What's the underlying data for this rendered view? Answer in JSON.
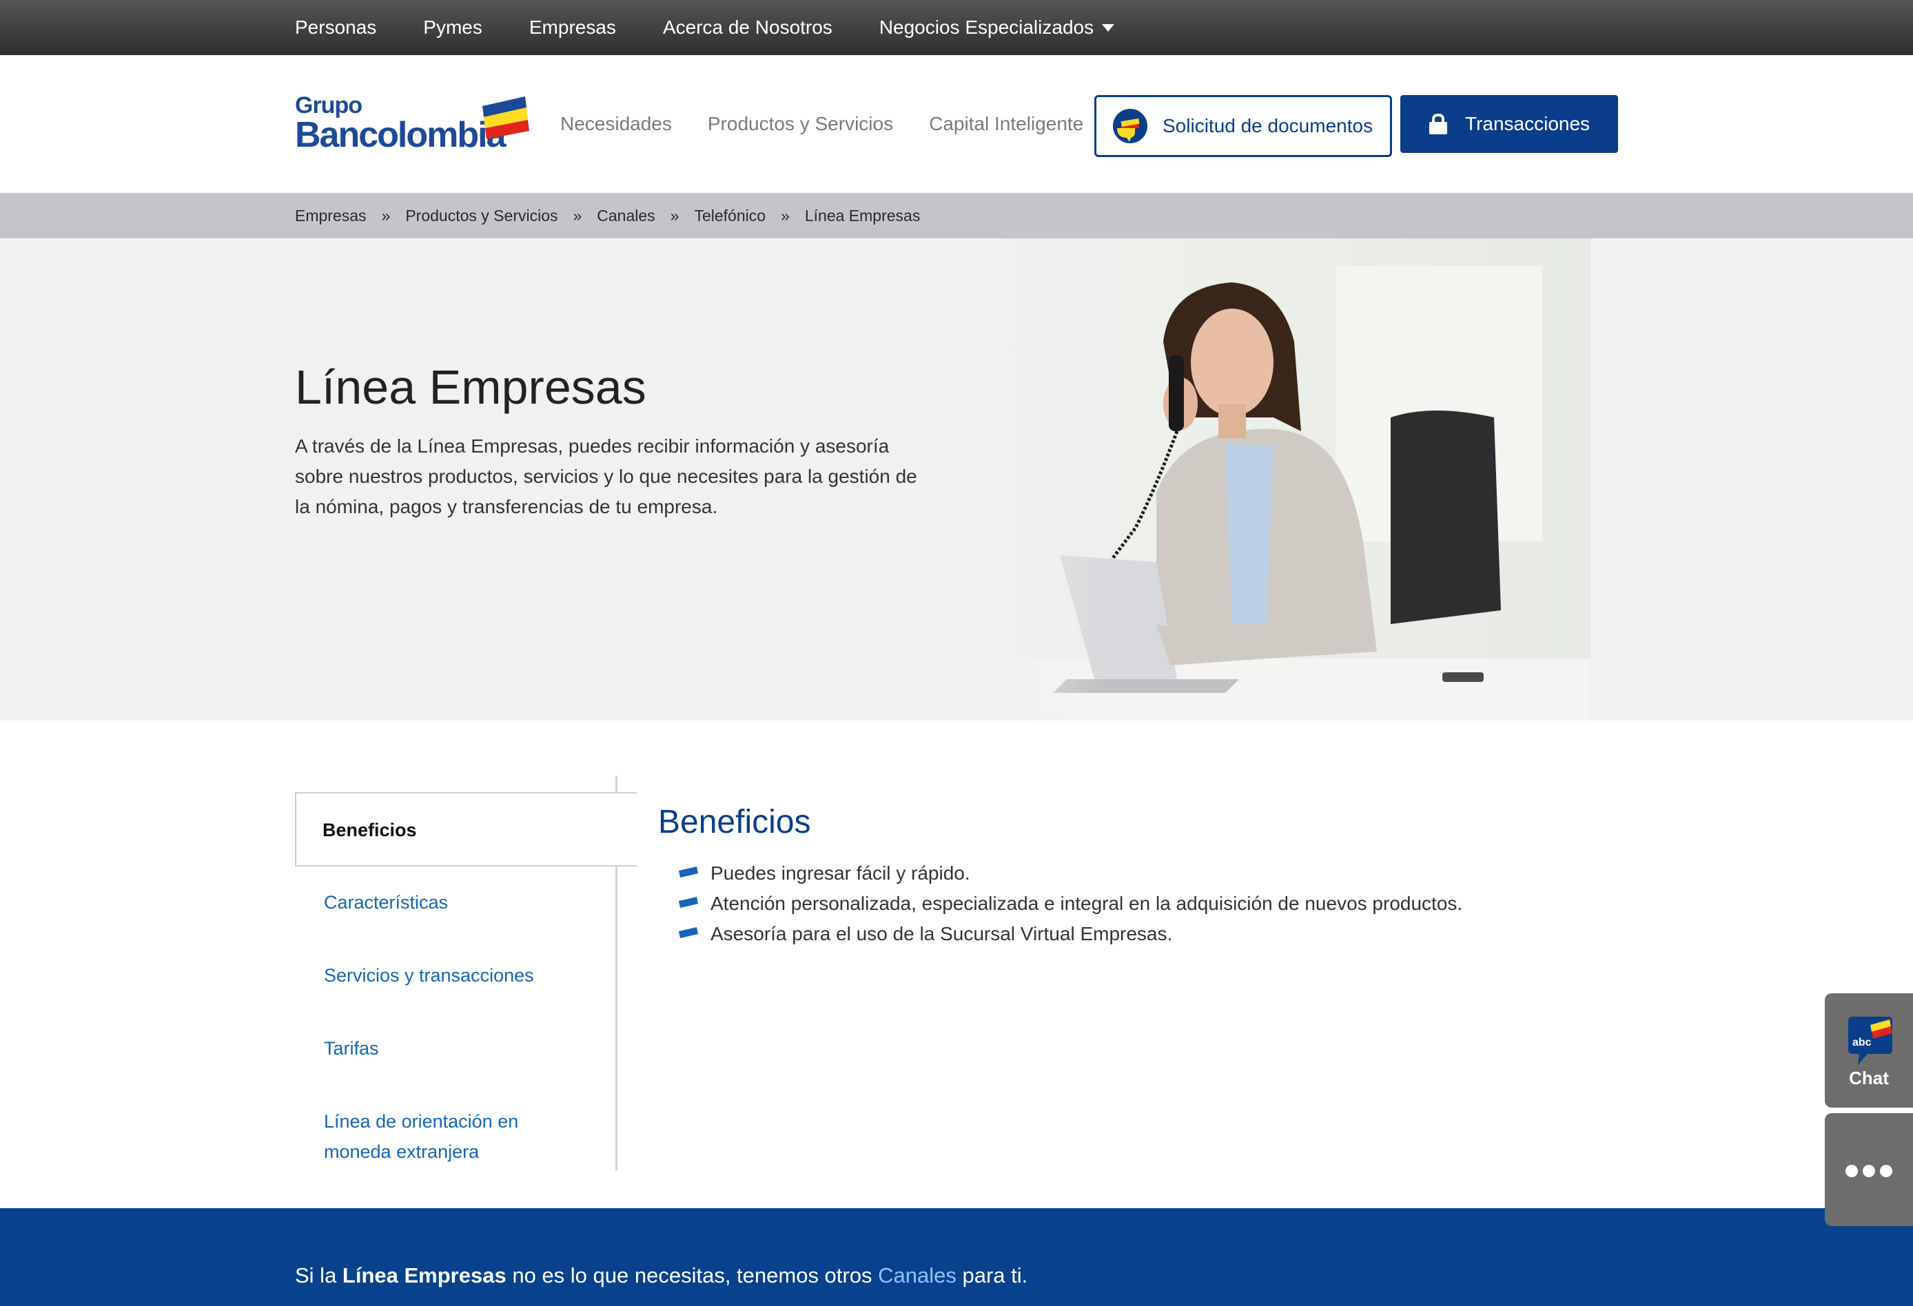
{
  "topnav": {
    "items": [
      "Personas",
      "Pymes",
      "Empresas",
      "Acerca de Nosotros",
      "Negocios Especializados"
    ]
  },
  "header": {
    "logo_line1": "Grupo",
    "logo_line2": "Bancolombia",
    "nav": [
      "Necesidades",
      "Productos y Servicios",
      "Capital Inteligente"
    ],
    "docs_button": "Solicitud de documentos",
    "transactions_button": "Transacciones"
  },
  "breadcrumb": {
    "items": [
      "Empresas",
      "Productos y Servicios",
      "Canales",
      "Telefónico",
      "Línea Empresas"
    ],
    "separator": "»"
  },
  "hero": {
    "title": "Línea Empresas",
    "description": "A través de la Línea Empresas, puedes recibir información y asesoría sobre nuestros productos, servicios y lo que necesites para la gestión de la nómina, pagos y transferencias de tu empresa."
  },
  "tabs": {
    "active": "Beneficios",
    "items": [
      "Características",
      "Servicios y transacciones",
      "Tarifas",
      "Línea de orientación en moneda extranjera"
    ]
  },
  "content": {
    "title": "Beneficios",
    "bullets": [
      "Puedes ingresar fácil y rápido.",
      "Atención personalizada, especializada e integral en la adquisición de nuevos productos.",
      "Asesoría para el uso de la Sucursal Virtual Empresas."
    ]
  },
  "widgets": {
    "chat_badge": "abc",
    "chat_label": "Chat"
  },
  "footer_band": {
    "prefix": "Si la ",
    "bold": "Línea Empresas",
    "middle": " no es lo que necesitas, tenemos otros ",
    "link": "Canales",
    "suffix": " para ti."
  },
  "colors": {
    "brand_blue": "#0a3d8a",
    "link_blue": "#1565b5",
    "band_blue": "#08428c",
    "topbar_dark": "#3a3a3a",
    "logo_yellow": "#fdda24",
    "logo_red": "#e1251b"
  }
}
